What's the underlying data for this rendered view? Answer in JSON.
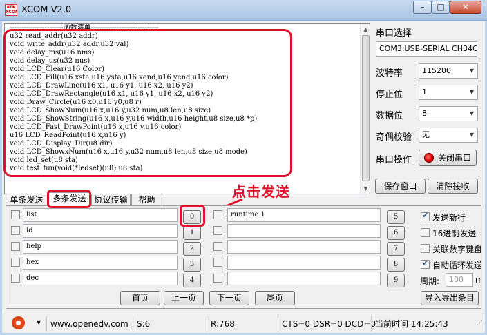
{
  "window": {
    "logo_text": "ATK\nXCOM",
    "title": "XCOM V2.0",
    "min": "–",
    "max": "□",
    "close": "✕"
  },
  "receive_lines": [
    "-----------------------函数清单-----------------------------",
    "u32 read_addr(u32 addr)",
    "void write_addr(u32 addr,u32 val)",
    "void delay_ms(u16 nms)",
    "void delay_us(u32 nus)",
    "void LCD_Clear(u16 Color)",
    "void LCD_Fill(u16 xsta,u16 ysta,u16 xend,u16 yend,u16 color)",
    "void LCD_DrawLine(u16 x1, u16 y1, u16 x2, u16 y2)",
    "void LCD_DrawRectangle(u16 x1, u16 y1, u16 x2, u16 y2)",
    "void Draw_Circle(u16 x0,u16 y0,u8 r)",
    "void LCD_ShowNum(u16 x,u16 y,u32 num,u8 len,u8 size)",
    "void LCD_ShowString(u16 x,u16 y,u16 width,u16 height,u8 size,u8 *p)",
    "void LCD_Fast_DrawPoint(u16 x,u16 y,u16 color)",
    "u16 LCD_ReadPoint(u16 x,u16 y)",
    "void LCD_Display_Dir(u8 dir)",
    "void LCD_ShowxNum(u16 x,u16 y,u32 num,u8 len,u8 size,u8 mode)",
    "void led_set(u8 sta)",
    "void test_fun(void(*ledset)(u8),u8 sta)"
  ],
  "serial": {
    "port_label": "串口选择",
    "port_value": "COM3:USB-SERIAL CH34C",
    "baud_label": "波特率",
    "baud_value": "115200",
    "stop_label": "停止位",
    "stop_value": "1",
    "data_label": "数据位",
    "data_value": "8",
    "parity_label": "奇偶校验",
    "parity_value": "无",
    "op_label": "串口操作",
    "op_button": "关闭串口",
    "save_button": "保存窗口",
    "clear_button": "清除接收"
  },
  "tabs": [
    "单条发送",
    "多条发送",
    "协议传输",
    "帮助"
  ],
  "annotation": "点击发送",
  "multi_send": {
    "left": [
      {
        "text": "list",
        "btn": "0"
      },
      {
        "text": "id",
        "btn": "1"
      },
      {
        "text": "help",
        "btn": "2"
      },
      {
        "text": "hex",
        "btn": "3"
      },
      {
        "text": "dec",
        "btn": "4"
      }
    ],
    "right": [
      {
        "text": "runtime 1",
        "btn": "5"
      },
      {
        "text": "",
        "btn": "6"
      },
      {
        "text": "",
        "btn": "7"
      },
      {
        "text": "",
        "btn": "8"
      },
      {
        "text": "",
        "btn": "9"
      }
    ],
    "options": {
      "send_newline": "发送新行",
      "hex_send": "16进制发送",
      "link_numpad": "关联数字键盘",
      "auto_loop": "自动循环发送",
      "period_label": "周期:",
      "period_value": "100",
      "period_unit": "ms"
    },
    "nav": {
      "first": "首页",
      "prev": "上一页",
      "next": "下一页",
      "last": "尾页",
      "import_export": "导入导出条目"
    }
  },
  "status": {
    "url": "www.openedv.com",
    "s": "S:6",
    "r": "R:768",
    "lines": "CTS=0 DSR=0 DCD=0",
    "time": "当前时间 14:25:43"
  }
}
